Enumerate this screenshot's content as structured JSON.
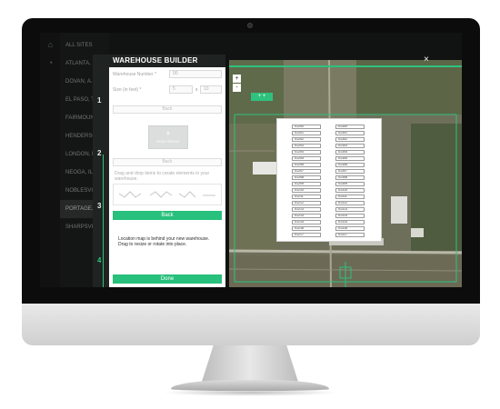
{
  "sidebar": {
    "items": [
      {
        "label": "ALL SITES"
      },
      {
        "label": "ATLANTA, N..."
      },
      {
        "label": "DOVAN, A..."
      },
      {
        "label": "EL PASO, T..."
      },
      {
        "label": "FAIRMOUNT, R..."
      },
      {
        "label": "HENDERSON, N..."
      },
      {
        "label": "LONDON, K..."
      },
      {
        "label": "NEOGA, IL"
      },
      {
        "label": "NOBLESVILLE..."
      },
      {
        "label": "PORTAGE..."
      },
      {
        "label": "SHARPSVILLE, I..."
      }
    ],
    "active_index": 9
  },
  "builder": {
    "title": "WAREHOUSE BUILDER",
    "steps": [
      "1",
      "2",
      "3",
      "4"
    ],
    "warehouse_number_label": "Warehouse Number *",
    "warehouse_number_value": "90",
    "size_label": "Size (in feet) *",
    "size_width": "5",
    "size_x": "x",
    "size_height": "10",
    "back_label": "Back",
    "row_group_plus": "+",
    "row_group_label": "ROW GROUP",
    "drag_text": "Drag and drop items to create elements in your warehouse.",
    "note": "Location map is behind your new warehouse. Drag to resize or rotate into place.",
    "done_label": "Done"
  },
  "map": {
    "close": "×",
    "zoom_in": "+",
    "zoom_out": "-",
    "overlay_plus": "+ +"
  },
  "warehouse": {
    "left_column": [
      "01200",
      "01201",
      "01202",
      "01203",
      "01204",
      "01205",
      "01206",
      "01207",
      "01208",
      "01209",
      "01210",
      "01211",
      "01212",
      "01213",
      "01214",
      "01215",
      "01216",
      "01217"
    ],
    "right_column": [
      "01300",
      "01301",
      "01302",
      "01303",
      "01304",
      "01305",
      "01306",
      "01307",
      "01308",
      "01309",
      "01310",
      "01311",
      "01312",
      "01313",
      "01314",
      "01315",
      "01316",
      "01317"
    ]
  },
  "colors": {
    "accent": "#27c07c",
    "app_bg": "#1b1d1c"
  }
}
